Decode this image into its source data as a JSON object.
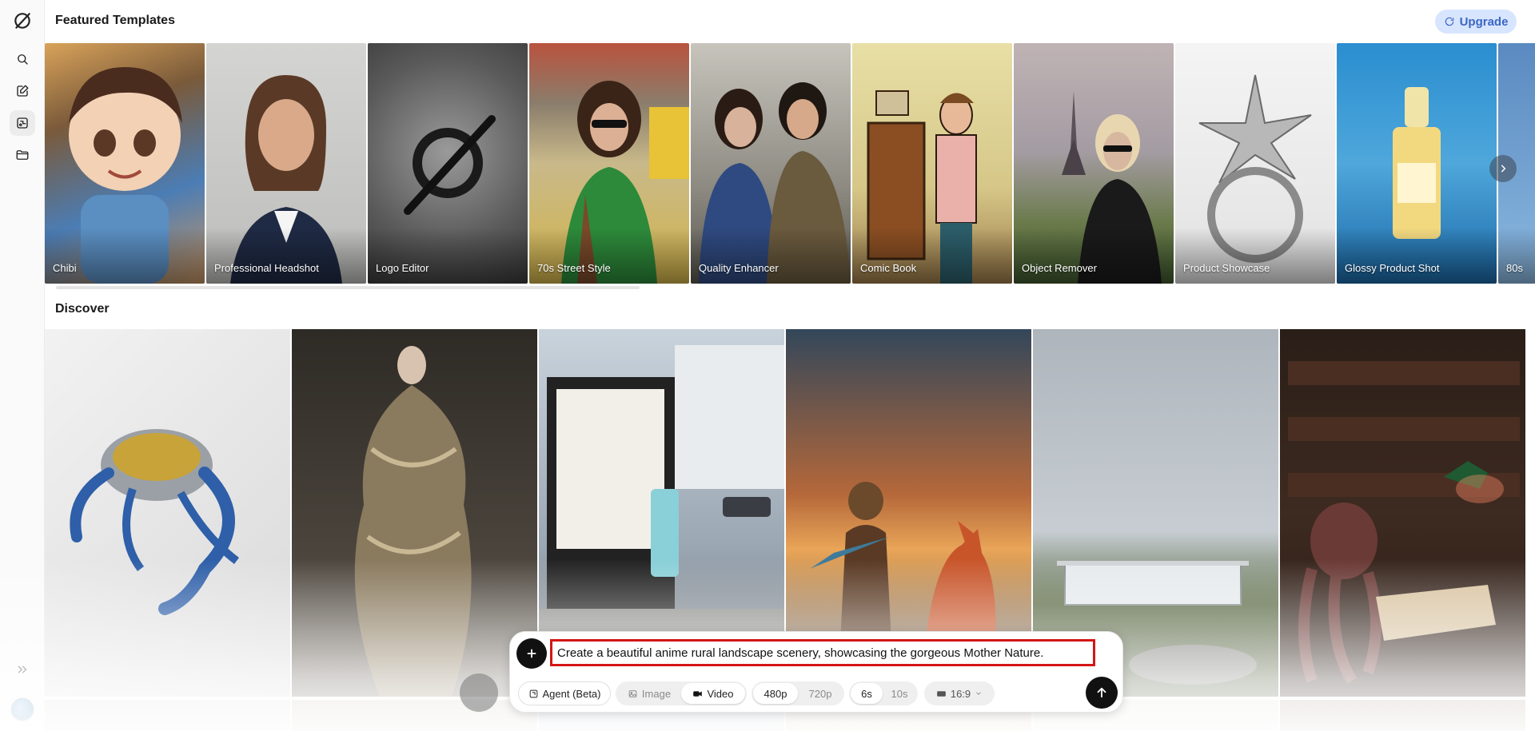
{
  "sidebar": {
    "items": [
      {
        "icon": "logo-icon"
      },
      {
        "icon": "search-icon"
      },
      {
        "icon": "edit-icon"
      },
      {
        "icon": "templates-icon",
        "active": true
      },
      {
        "icon": "folder-icon"
      }
    ],
    "expand_icon": "double-chevron-right-icon"
  },
  "header": {
    "featured_title": "Featured Templates",
    "upgrade_label": "Upgrade"
  },
  "templates": [
    {
      "label": "Chibi"
    },
    {
      "label": "Professional Headshot"
    },
    {
      "label": "Logo Editor"
    },
    {
      "label": "70s Street Style"
    },
    {
      "label": "Quality Enhancer"
    },
    {
      "label": "Comic Book"
    },
    {
      "label": "Object Remover"
    },
    {
      "label": "Product Showcase"
    },
    {
      "label": "Glossy Product Shot"
    },
    {
      "label": "80s"
    }
  ],
  "discover": {
    "title": "Discover"
  },
  "prompt": {
    "text": "Create a beautiful anime rural landscape scenery, showcasing the gorgeous Mother Nature.",
    "agent_label": "Agent (Beta)",
    "image_label": "Image",
    "video_label": "Video",
    "res_480": "480p",
    "res_720": "720p",
    "dur_6": "6s",
    "dur_10": "10s",
    "aspect": "16:9"
  },
  "colors": {
    "accent": "#3a66c4",
    "upgrade_bg": "#d8e5ff",
    "highlight_border": "#d41515"
  }
}
